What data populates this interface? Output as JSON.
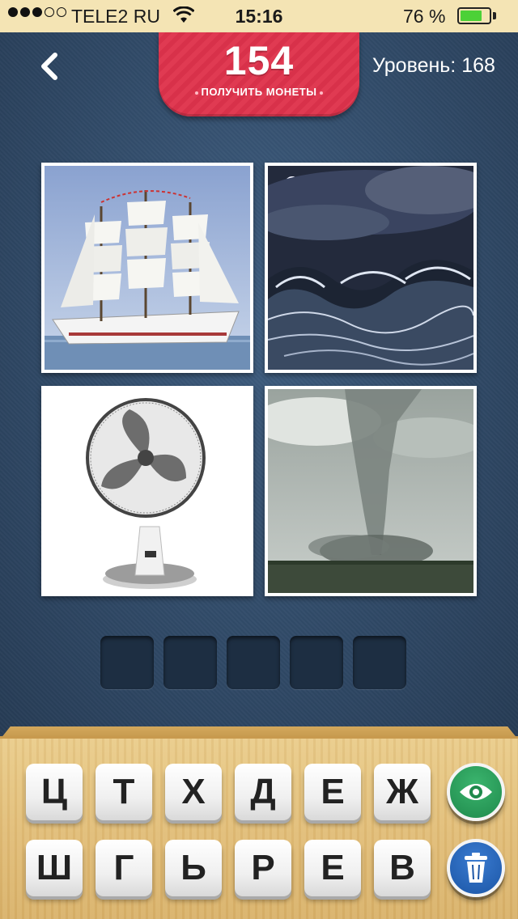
{
  "status_bar": {
    "carrier": "TELE2 RU",
    "time": "15:16",
    "battery": "76 %",
    "battery_level": 0.76,
    "signal_bars_filled": 3,
    "signal_bars_total": 5
  },
  "header": {
    "coins": "154",
    "get_coins_label": "ПОЛУЧИТЬ МОНЕТЫ",
    "level_label": "Уровень: 168",
    "back_icon": "chevron-left-icon"
  },
  "pictures": [
    {
      "subject": "sailing-ship"
    },
    {
      "subject": "stormy-sea"
    },
    {
      "subject": "electric-fan"
    },
    {
      "subject": "tornado"
    }
  ],
  "answer_slots": [
    "",
    "",
    "",
    "",
    ""
  ],
  "keyboard": {
    "row1": [
      "Ц",
      "Т",
      "Х",
      "Д",
      "Е",
      "Ж"
    ],
    "row2": [
      "Ш",
      "Г",
      "Ь",
      "Р",
      "Е",
      "В"
    ],
    "hint_icon": "eye-icon",
    "remove_icon": "trash-icon"
  },
  "colors": {
    "background": "#2d4560",
    "coins_badge": "#e03a52",
    "hint_button": "#2a9d5c",
    "remove_button": "#2567bb",
    "wood": "#e2be78"
  }
}
